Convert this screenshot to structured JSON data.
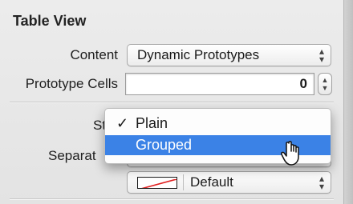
{
  "inspector": {
    "section_title": "Table View",
    "content": {
      "label": "Content",
      "value": "Dynamic Prototypes"
    },
    "prototype_cells": {
      "label": "Prototype Cells",
      "value": "0"
    },
    "style": {
      "label_visible": "Sty"
    },
    "separator": {
      "label_visible": "Separat"
    },
    "separator_color": {
      "value": "Default"
    }
  },
  "style_menu": {
    "items": [
      {
        "label": "Plain",
        "checkmark": "✓"
      },
      {
        "label": "Grouped"
      }
    ]
  }
}
